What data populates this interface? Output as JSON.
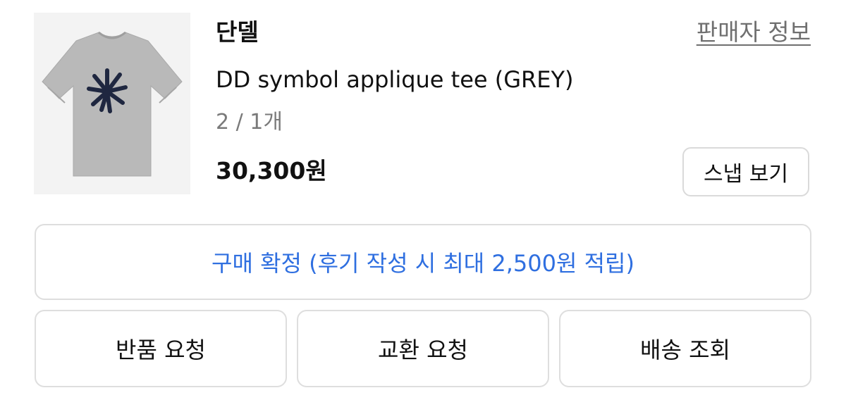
{
  "order_item": {
    "image_icon": "grey-tshirt-with-navy-symbol",
    "brand": "단델",
    "seller_info_link": "판매자 정보",
    "product_name": "DD symbol applique tee (GREY)",
    "option_quantity": "2 / 1개",
    "price": "30,300원",
    "snap_button": "스냅 보기"
  },
  "actions": {
    "confirm_purchase": "구매 확정 (후기 작성 시 최대 2,500원 적립)",
    "return_request": "반품 요청",
    "exchange_request": "교환 요청",
    "delivery_tracking": "배송 조회"
  },
  "colors": {
    "confirm_text": "#2f6fe0",
    "shirt": "#b9b9b9",
    "symbol": "#1f2740"
  }
}
